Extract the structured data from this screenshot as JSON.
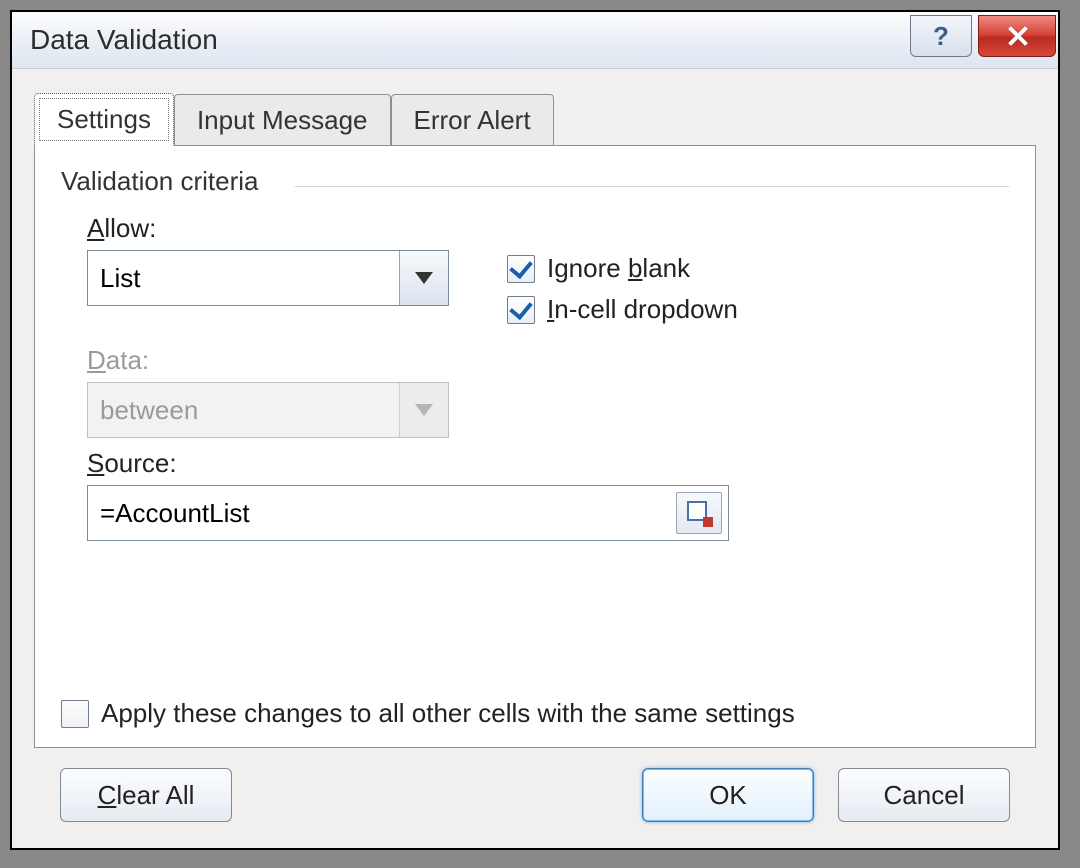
{
  "window": {
    "title": "Data Validation"
  },
  "tabs": {
    "settings": "Settings",
    "input_message": "Input Message",
    "error_alert": "Error Alert"
  },
  "group": {
    "label": "Validation criteria"
  },
  "allow": {
    "label_pre": "",
    "label_ul": "A",
    "label_post": "llow:",
    "value": "List"
  },
  "data": {
    "label_pre": "",
    "label_ul": "D",
    "label_post": "ata:",
    "value": "between"
  },
  "source": {
    "label_pre": "",
    "label_ul": "S",
    "label_post": "ource:",
    "value": "=AccountList"
  },
  "checks": {
    "ignore_blank": {
      "pre": "Ignore ",
      "ul": "b",
      "post": "lank",
      "checked": true
    },
    "incell": {
      "pre": "",
      "ul": "I",
      "post": "n-cell dropdown",
      "checked": true
    }
  },
  "apply": {
    "pre": "Apply these changes to all other cells with the same settings",
    "checked": false
  },
  "buttons": {
    "clear": "Clear All",
    "clear_ul": "C",
    "clear_post": "lear All",
    "ok": "OK",
    "cancel": "Cancel"
  }
}
